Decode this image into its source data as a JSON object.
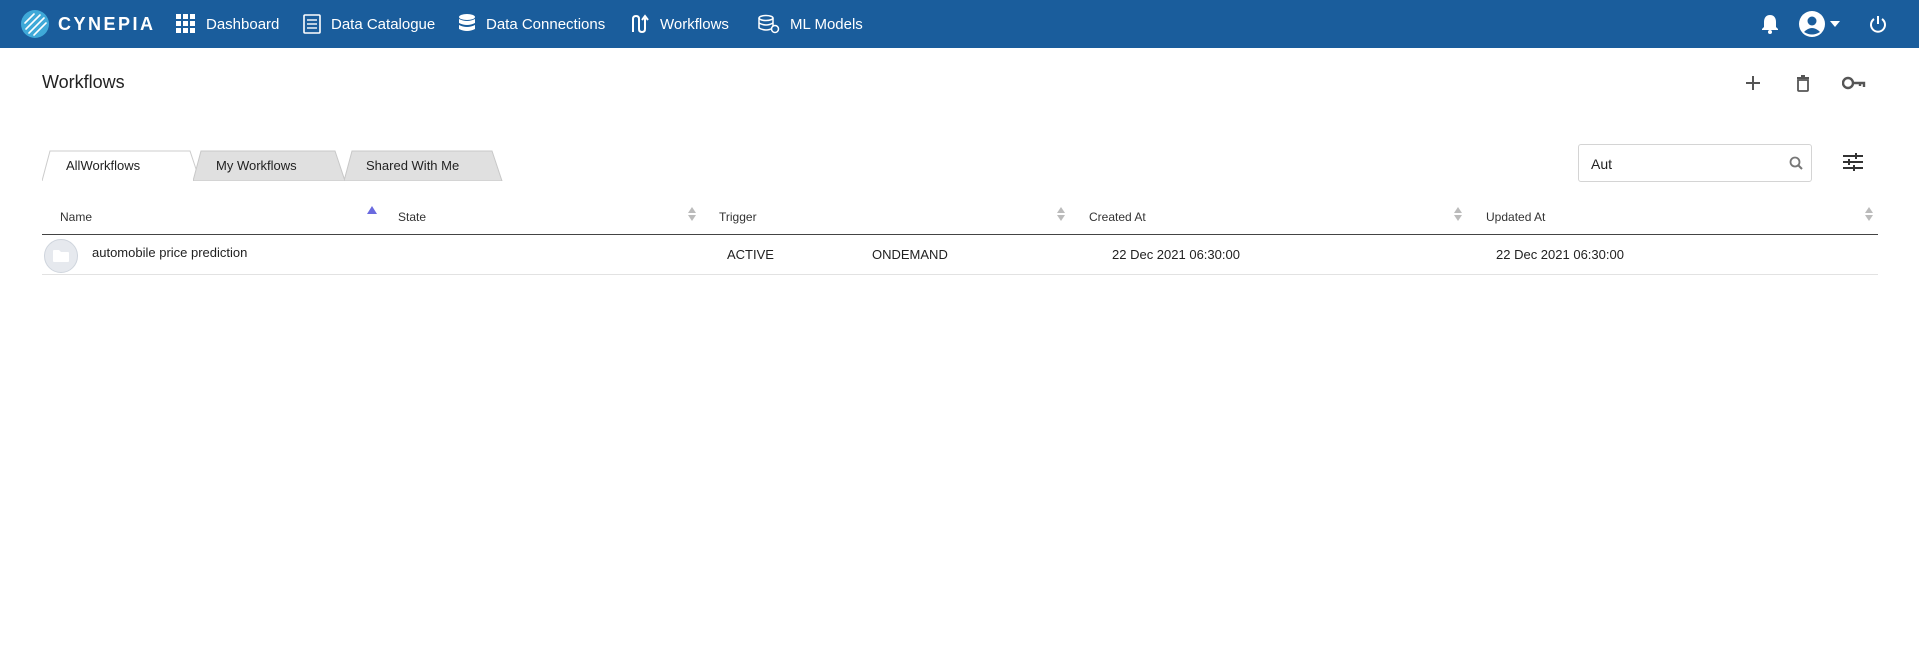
{
  "brand": {
    "name": "CYNEPIA"
  },
  "nav": {
    "items": [
      {
        "label": "Dashboard",
        "icon": "grid-icon"
      },
      {
        "label": "Data Catalogue",
        "icon": "document-icon"
      },
      {
        "label": "Data Connections",
        "icon": "database-icon"
      },
      {
        "label": "Workflows",
        "icon": "workflow-icon"
      },
      {
        "label": "ML Models",
        "icon": "ml-models-icon"
      }
    ],
    "right_icons": [
      "bell-icon",
      "account-icon",
      "caret-down-icon",
      "power-icon"
    ]
  },
  "header": {
    "title": "Workflows",
    "actions": [
      "add-icon",
      "trash-icon",
      "key-icon"
    ]
  },
  "tabs": [
    {
      "label": "AllWorkflows",
      "active": true
    },
    {
      "label": "My Workflows",
      "active": false
    },
    {
      "label": "Shared With Me",
      "active": false
    }
  ],
  "search": {
    "value": "Aut",
    "placeholder": ""
  },
  "table": {
    "columns": [
      "Name",
      "State",
      "Trigger",
      "Created At",
      "Updated At"
    ],
    "sorted_column": "Name",
    "rows": [
      {
        "name": "automobile price prediction",
        "state": "ACTIVE",
        "trigger": "ONDEMAND",
        "created_at": "22 Dec 2021 06:30:00",
        "updated_at": "22 Dec 2021 06:30:00"
      }
    ]
  },
  "colors": {
    "topbar": "#1a5d9c",
    "sort_active": "#6a6adf",
    "tab_inactive": "#e0e0e0"
  }
}
